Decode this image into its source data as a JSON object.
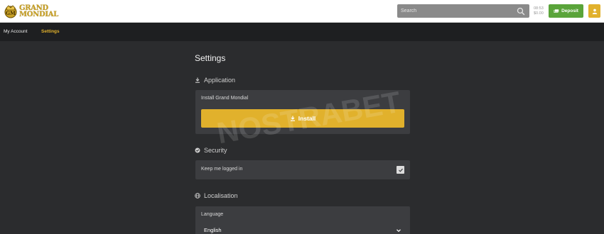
{
  "brand": {
    "logo_line1": "GRAND",
    "logo_line2": "MONDIAL"
  },
  "search": {
    "placeholder": "Search"
  },
  "balance": {
    "line1": "08:53",
    "line2": "$0.00"
  },
  "deposit": {
    "label": "Deposit"
  },
  "nav": {
    "items": [
      {
        "label": "My Account"
      },
      {
        "label": "Settings"
      }
    ]
  },
  "page": {
    "title": "Settings"
  },
  "application": {
    "heading": "Application",
    "install_label": "Install Grand Mondial",
    "install_button": "Install"
  },
  "security": {
    "heading": "Security",
    "keep_logged_in_label": "Keep me logged in",
    "keep_logged_in_checked": true
  },
  "localisation": {
    "heading": "Localisation",
    "language_label": "Language",
    "language_value": "English"
  },
  "watermark": {
    "text": "NOSTRABET"
  },
  "colors": {
    "accent": "#e1b12c",
    "deposit": "#5aa43a",
    "background": "#2b2c2e",
    "card": "#3c3d40"
  },
  "icons": {
    "search": "search-icon",
    "deposit": "cash-icon",
    "user": "user-icon",
    "application": "download-icon",
    "security": "shield-icon",
    "localisation": "globe-icon"
  }
}
